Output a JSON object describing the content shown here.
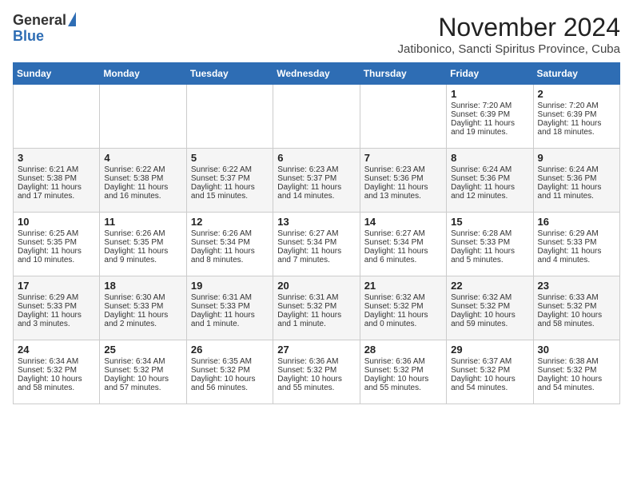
{
  "header": {
    "logo_general": "General",
    "logo_blue": "Blue",
    "month": "November 2024",
    "location": "Jatibonico, Sancti Spiritus Province, Cuba"
  },
  "days_of_week": [
    "Sunday",
    "Monday",
    "Tuesday",
    "Wednesday",
    "Thursday",
    "Friday",
    "Saturday"
  ],
  "weeks": [
    [
      {
        "day": "",
        "info": ""
      },
      {
        "day": "",
        "info": ""
      },
      {
        "day": "",
        "info": ""
      },
      {
        "day": "",
        "info": ""
      },
      {
        "day": "",
        "info": ""
      },
      {
        "day": "1",
        "info": "Sunrise: 7:20 AM\nSunset: 6:39 PM\nDaylight: 11 hours and 19 minutes."
      },
      {
        "day": "2",
        "info": "Sunrise: 7:20 AM\nSunset: 6:39 PM\nDaylight: 11 hours and 18 minutes."
      }
    ],
    [
      {
        "day": "3",
        "info": "Sunrise: 6:21 AM\nSunset: 5:38 PM\nDaylight: 11 hours and 17 minutes."
      },
      {
        "day": "4",
        "info": "Sunrise: 6:22 AM\nSunset: 5:38 PM\nDaylight: 11 hours and 16 minutes."
      },
      {
        "day": "5",
        "info": "Sunrise: 6:22 AM\nSunset: 5:37 PM\nDaylight: 11 hours and 15 minutes."
      },
      {
        "day": "6",
        "info": "Sunrise: 6:23 AM\nSunset: 5:37 PM\nDaylight: 11 hours and 14 minutes."
      },
      {
        "day": "7",
        "info": "Sunrise: 6:23 AM\nSunset: 5:36 PM\nDaylight: 11 hours and 13 minutes."
      },
      {
        "day": "8",
        "info": "Sunrise: 6:24 AM\nSunset: 5:36 PM\nDaylight: 11 hours and 12 minutes."
      },
      {
        "day": "9",
        "info": "Sunrise: 6:24 AM\nSunset: 5:36 PM\nDaylight: 11 hours and 11 minutes."
      }
    ],
    [
      {
        "day": "10",
        "info": "Sunrise: 6:25 AM\nSunset: 5:35 PM\nDaylight: 11 hours and 10 minutes."
      },
      {
        "day": "11",
        "info": "Sunrise: 6:26 AM\nSunset: 5:35 PM\nDaylight: 11 hours and 9 minutes."
      },
      {
        "day": "12",
        "info": "Sunrise: 6:26 AM\nSunset: 5:34 PM\nDaylight: 11 hours and 8 minutes."
      },
      {
        "day": "13",
        "info": "Sunrise: 6:27 AM\nSunset: 5:34 PM\nDaylight: 11 hours and 7 minutes."
      },
      {
        "day": "14",
        "info": "Sunrise: 6:27 AM\nSunset: 5:34 PM\nDaylight: 11 hours and 6 minutes."
      },
      {
        "day": "15",
        "info": "Sunrise: 6:28 AM\nSunset: 5:33 PM\nDaylight: 11 hours and 5 minutes."
      },
      {
        "day": "16",
        "info": "Sunrise: 6:29 AM\nSunset: 5:33 PM\nDaylight: 11 hours and 4 minutes."
      }
    ],
    [
      {
        "day": "17",
        "info": "Sunrise: 6:29 AM\nSunset: 5:33 PM\nDaylight: 11 hours and 3 minutes."
      },
      {
        "day": "18",
        "info": "Sunrise: 6:30 AM\nSunset: 5:33 PM\nDaylight: 11 hours and 2 minutes."
      },
      {
        "day": "19",
        "info": "Sunrise: 6:31 AM\nSunset: 5:33 PM\nDaylight: 11 hours and 1 minute."
      },
      {
        "day": "20",
        "info": "Sunrise: 6:31 AM\nSunset: 5:32 PM\nDaylight: 11 hours and 1 minute."
      },
      {
        "day": "21",
        "info": "Sunrise: 6:32 AM\nSunset: 5:32 PM\nDaylight: 11 hours and 0 minutes."
      },
      {
        "day": "22",
        "info": "Sunrise: 6:32 AM\nSunset: 5:32 PM\nDaylight: 10 hours and 59 minutes."
      },
      {
        "day": "23",
        "info": "Sunrise: 6:33 AM\nSunset: 5:32 PM\nDaylight: 10 hours and 58 minutes."
      }
    ],
    [
      {
        "day": "24",
        "info": "Sunrise: 6:34 AM\nSunset: 5:32 PM\nDaylight: 10 hours and 58 minutes."
      },
      {
        "day": "25",
        "info": "Sunrise: 6:34 AM\nSunset: 5:32 PM\nDaylight: 10 hours and 57 minutes."
      },
      {
        "day": "26",
        "info": "Sunrise: 6:35 AM\nSunset: 5:32 PM\nDaylight: 10 hours and 56 minutes."
      },
      {
        "day": "27",
        "info": "Sunrise: 6:36 AM\nSunset: 5:32 PM\nDaylight: 10 hours and 55 minutes."
      },
      {
        "day": "28",
        "info": "Sunrise: 6:36 AM\nSunset: 5:32 PM\nDaylight: 10 hours and 55 minutes."
      },
      {
        "day": "29",
        "info": "Sunrise: 6:37 AM\nSunset: 5:32 PM\nDaylight: 10 hours and 54 minutes."
      },
      {
        "day": "30",
        "info": "Sunrise: 6:38 AM\nSunset: 5:32 PM\nDaylight: 10 hours and 54 minutes."
      }
    ]
  ]
}
